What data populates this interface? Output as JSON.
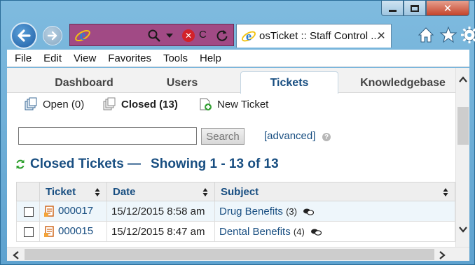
{
  "window": {
    "close_glyph": "✕"
  },
  "address_bar": {
    "stop_glyph": "✕",
    "truncated_text": "C"
  },
  "tab": {
    "title": "osTicket :: Staff Control ...",
    "close_glyph": "✕"
  },
  "menu": {
    "items": [
      "File",
      "Edit",
      "View",
      "Favorites",
      "Tools",
      "Help"
    ]
  },
  "page_nav": {
    "tabs": [
      "Dashboard",
      "Users",
      "Tickets",
      "Knowledgebase"
    ],
    "active": "Tickets"
  },
  "subnav": {
    "open": "Open (0)",
    "closed": "Closed (13)",
    "new_ticket": "New Ticket"
  },
  "search": {
    "value": "",
    "button_label": "Search",
    "advanced_label": "[advanced]",
    "help_glyph": "?"
  },
  "heading": {
    "title": "Closed Tickets —",
    "showing": "Showing  1 - 13 of 13"
  },
  "table": {
    "headers": [
      "Ticket",
      "Date",
      "Subject"
    ],
    "rows": [
      {
        "ticket": "000017",
        "date": "15/12/2015 8:58 am",
        "subject": "Drug Benefits",
        "count": "(3)"
      },
      {
        "ticket": "000015",
        "date": "15/12/2015 8:47 am",
        "subject": "Dental Benefits",
        "count": "(4)"
      }
    ]
  },
  "colors": {
    "link": "#184e81",
    "address_bar_bg": "#a14a85",
    "close_button": "#c4432a",
    "alt_row": "#eef6fb"
  }
}
